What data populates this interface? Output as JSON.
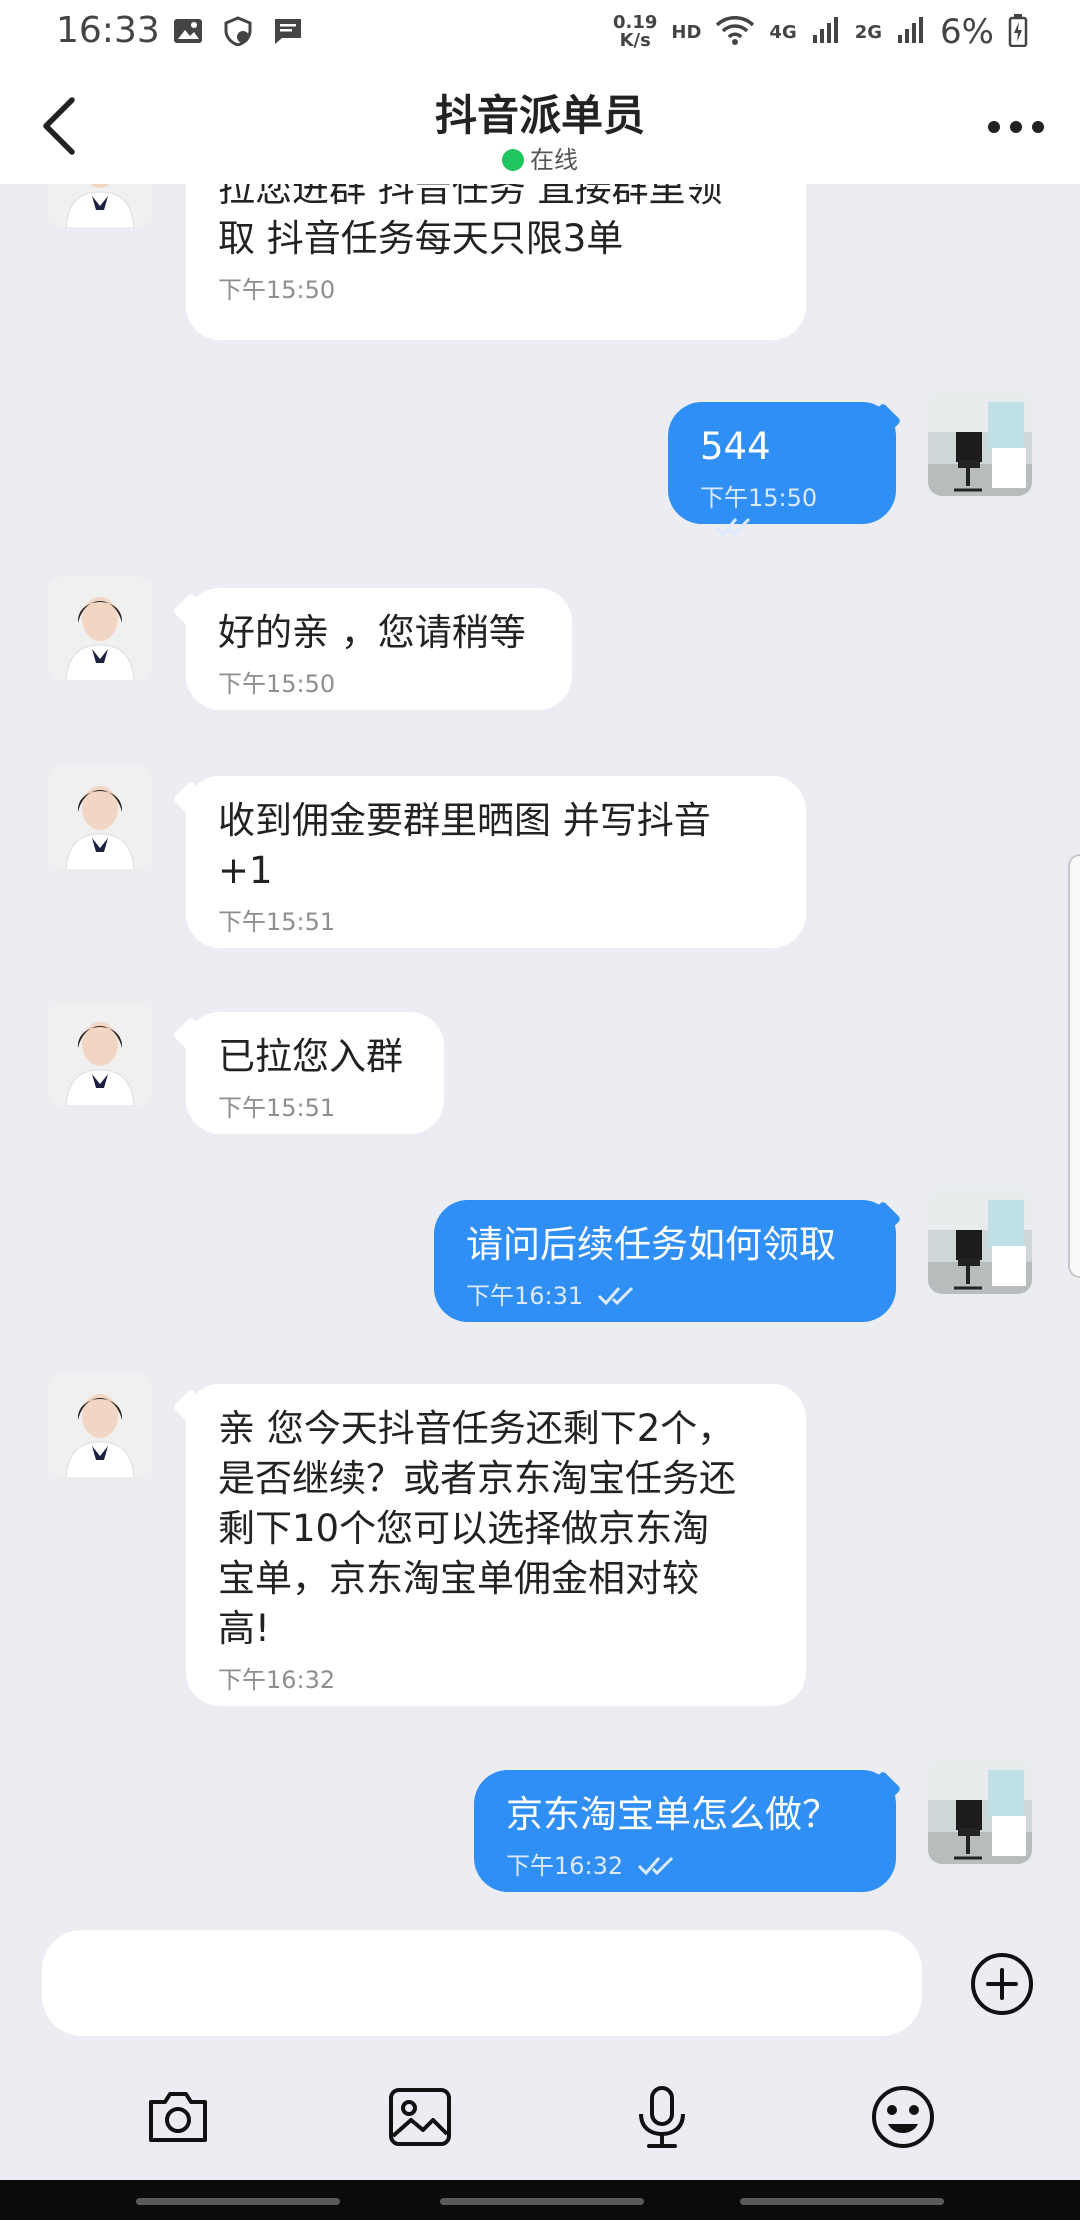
{
  "status_bar": {
    "time": "16:33",
    "speed_value": "0.19",
    "speed_unit": "K/s",
    "hd": "HD",
    "network_4g": "4G",
    "network_2g": "2G",
    "battery": "6%",
    "icons": [
      "image-icon",
      "shield-icon",
      "message-icon",
      "wifi-icon",
      "signal-icon",
      "battery-icon"
    ]
  },
  "header": {
    "title": "抖音派单员",
    "status": "在线",
    "status_color": "#23c55e"
  },
  "messages": [
    {
      "side": "in",
      "text_lines": [
        "拉您进群 抖音任务 直接群里领",
        "取 抖音任务每天只限3单"
      ],
      "time": "下午15:50"
    },
    {
      "side": "out",
      "text_lines": [
        "544"
      ],
      "time": "下午15:50"
    },
    {
      "side": "in",
      "text_lines": [
        "好的亲 ，您请稍等"
      ],
      "time": "下午15:50"
    },
    {
      "side": "in",
      "text_lines": [
        "收到佣金要群里晒图 并写抖音",
        "+1"
      ],
      "time": "下午15:51"
    },
    {
      "side": "in",
      "text_lines": [
        "已拉您入群"
      ],
      "time": "下午15:51"
    },
    {
      "side": "out",
      "text_lines": [
        "请问后续任务如何领取"
      ],
      "time": "下午16:31"
    },
    {
      "side": "in",
      "text_lines": [
        "亲 您今天抖音任务还剩下2个，",
        "是否继续？或者京东淘宝任务还",
        "剩下10个您可以选择做京东淘",
        "宝单，京东淘宝单佣金相对较",
        "高!"
      ],
      "time": "下午16:32"
    },
    {
      "side": "out",
      "text_lines": [
        "京东淘宝单怎么做？"
      ],
      "time": "下午16:32"
    }
  ],
  "input": {
    "value": "",
    "placeholder": ""
  },
  "toolbar": [
    "camera-icon",
    "gallery-icon",
    "microphone-icon",
    "emoji-icon"
  ],
  "colors": {
    "accent": "#2f8ff5",
    "background": "#ebedf2"
  }
}
